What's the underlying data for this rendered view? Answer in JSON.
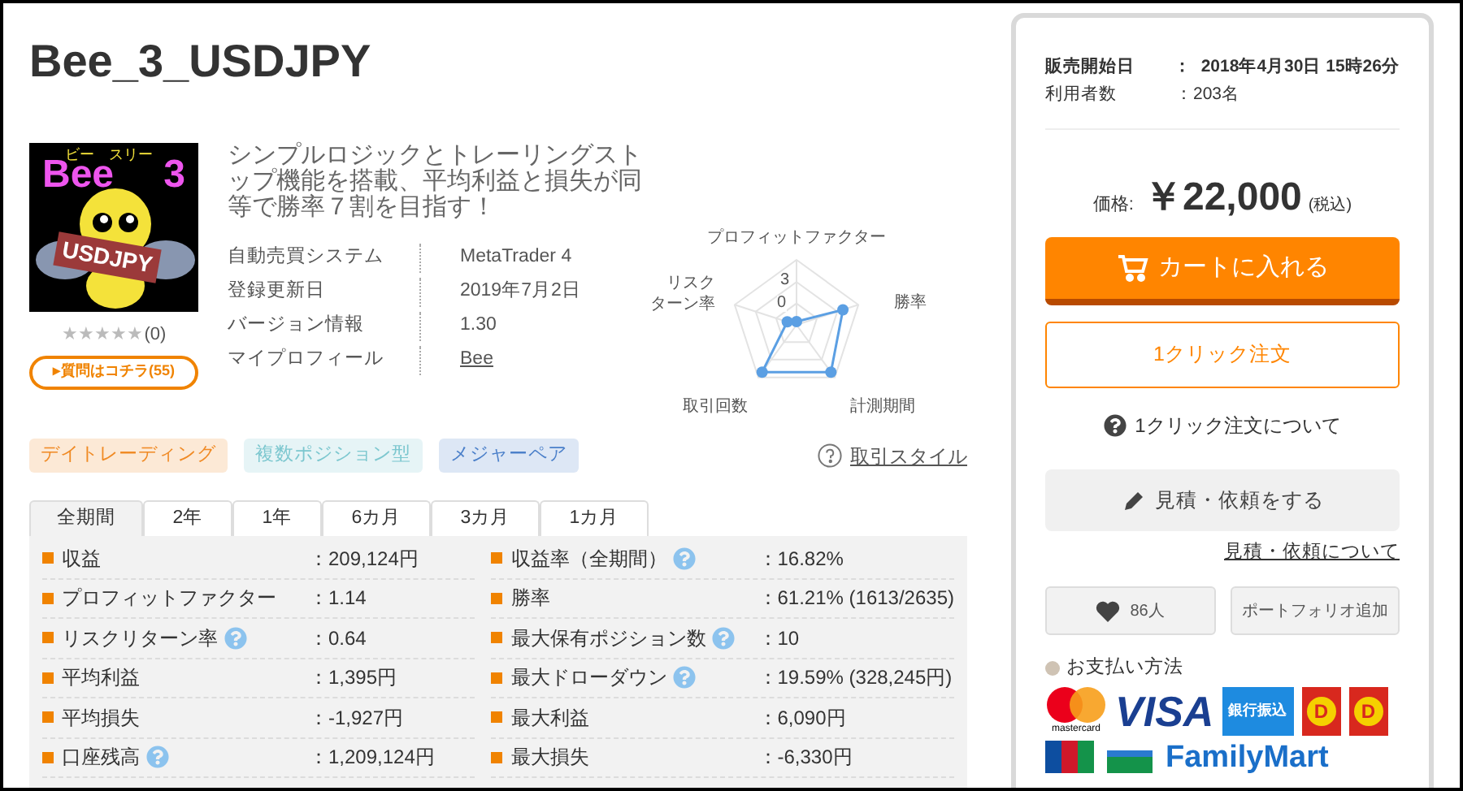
{
  "title": "Bee_3_USDJPY",
  "product": {
    "logo": {
      "ruby": "ビー　スリー",
      "name": "Bee",
      "number": "3",
      "tag": "USDJPY"
    },
    "stars": 0,
    "review_count": "(0)",
    "question_button": "質問はコチラ(55)",
    "question_arrow": "▸",
    "description": "シンプルロジックとトレーリングストップ機能を搭載、平均利益と損失が同等で勝率７割を目指す！",
    "info": [
      {
        "label": "自動売買システム",
        "value": "MetaTrader 4",
        "kind": "text"
      },
      {
        "label": "登録更新日",
        "value": "2019年7月2日",
        "kind": "text"
      },
      {
        "label": "バージョン情報",
        "value": "1.30",
        "kind": "text"
      },
      {
        "label": "マイプロフィール",
        "value": "Bee",
        "kind": "link"
      }
    ]
  },
  "radar": {
    "axes": [
      "プロフィットファクター",
      "リスクターン率",
      "勝率",
      "取引回数",
      "計測期間"
    ],
    "tick_max": "3",
    "tick_min": "0"
  },
  "tags": [
    {
      "label": "デイトレーディング",
      "color": "#f08a24"
    },
    {
      "label": "複数ポジション型",
      "color": "#7cc7cf"
    },
    {
      "label": "メジャーペア",
      "color": "#4a7fc9"
    }
  ],
  "style_link": "取引スタイル",
  "tabs": [
    {
      "label": "全期間",
      "selected": true
    },
    {
      "label": "2年",
      "selected": false
    },
    {
      "label": "1年",
      "selected": false
    },
    {
      "label": "6カ月",
      "selected": false
    },
    {
      "label": "3カ月",
      "selected": false
    },
    {
      "label": "1カ月",
      "selected": false
    }
  ],
  "stats_left": [
    {
      "label": "収益",
      "help": false,
      "value": "：209,124円"
    },
    {
      "label": "プロフィットファクター",
      "help": false,
      "value": "：1.14"
    },
    {
      "label": "リスクリターン率",
      "help": true,
      "value": "：0.64"
    },
    {
      "label": "平均利益",
      "help": false,
      "value": "：1,395円"
    },
    {
      "label": "平均損失",
      "help": false,
      "value": "：-1,927円"
    },
    {
      "label": "口座残高",
      "help": true,
      "value": "：1,209,124円"
    }
  ],
  "stats_right": [
    {
      "label": "収益率（全期間）",
      "help": true,
      "value": "：16.82%"
    },
    {
      "label": "勝率",
      "help": false,
      "value": "：61.21% (1613/2635)"
    },
    {
      "label": "最大保有ポジション数",
      "help": true,
      "value": "：10"
    },
    {
      "label": "最大ドローダウン",
      "help": true,
      "value": "：19.59% (328,245円)"
    },
    {
      "label": "最大利益",
      "help": false,
      "value": "：6,090円"
    },
    {
      "label": "最大損失",
      "help": false,
      "value": "：-6,330円"
    }
  ],
  "sidebar": {
    "meta": [
      {
        "label": "販売開始日",
        "value": "：  2018年4月30日 15時26分",
        "bold": true
      },
      {
        "label": "利用者数",
        "value": "：203名",
        "bold": false
      }
    ],
    "price_label": "価格:",
    "price": "￥22,000",
    "tax": "(税込)",
    "cart_button": "カートに入れる",
    "one_click_button": "1クリック注文",
    "one_click_help": "1クリック注文について",
    "estimate_button": "見積・依頼をする",
    "estimate_link": "見積・依頼について",
    "like_count": "86人",
    "portfolio_button": "ポートフォリオ追加",
    "payment_title": "お支払い方法",
    "payments": [
      {
        "kind": "mastercard",
        "label": "mastercard"
      },
      {
        "kind": "visa",
        "label": "VISA"
      },
      {
        "kind": "bank",
        "label": "銀行振込"
      },
      {
        "kind": "daily",
        "label": "D"
      },
      {
        "kind": "daily2",
        "label": "D"
      }
    ],
    "payments_row2": [
      {
        "kind": "jcb"
      },
      {
        "kind": "famima",
        "label": "FamilyMart"
      }
    ]
  }
}
